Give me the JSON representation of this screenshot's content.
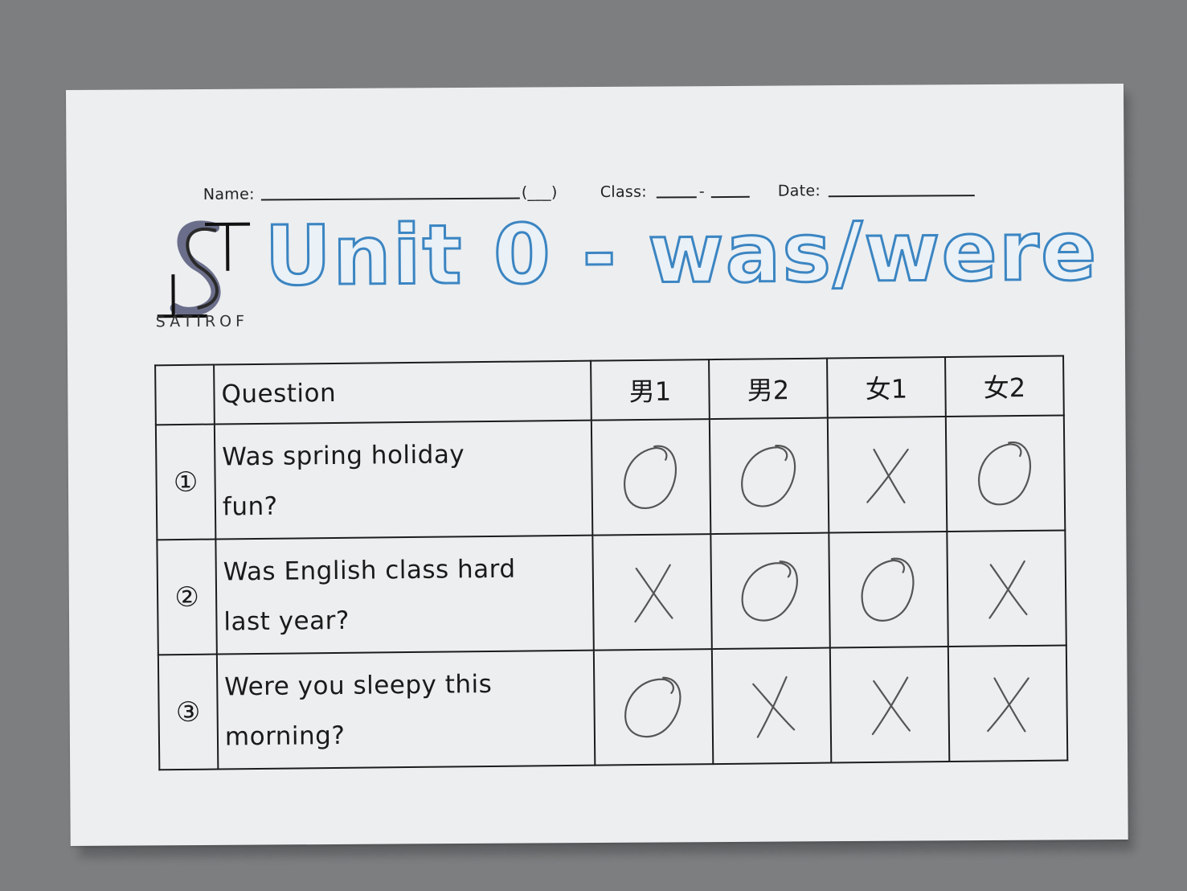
{
  "header": {
    "name_label": "Name:",
    "number_parens": "(___)",
    "class_label": "Class:",
    "class_sep": "-",
    "date_label": "Date:"
  },
  "logo": {
    "text": "SATIROF"
  },
  "title": "Unit 0 - was/were",
  "table": {
    "columns": [
      "",
      "Question",
      "男1",
      "男2",
      "女1",
      "女2"
    ],
    "rows": [
      {
        "num": "①",
        "q1": "Was spring holiday",
        "q2": "fun?",
        "marks": [
          "circle",
          "circle",
          "cross",
          "circle"
        ]
      },
      {
        "num": "②",
        "q1": "Was English class hard",
        "q2": "last year?",
        "marks": [
          "cross",
          "circle",
          "circle",
          "cross"
        ]
      },
      {
        "num": "③",
        "q1": "Were you sleepy this",
        "q2": "morning?",
        "marks": [
          "circle",
          "cross",
          "cross",
          "cross"
        ]
      }
    ]
  },
  "colors": {
    "title_outline": "#3b85c2",
    "ink": "#1a1a1a",
    "pencil": "#555555"
  }
}
